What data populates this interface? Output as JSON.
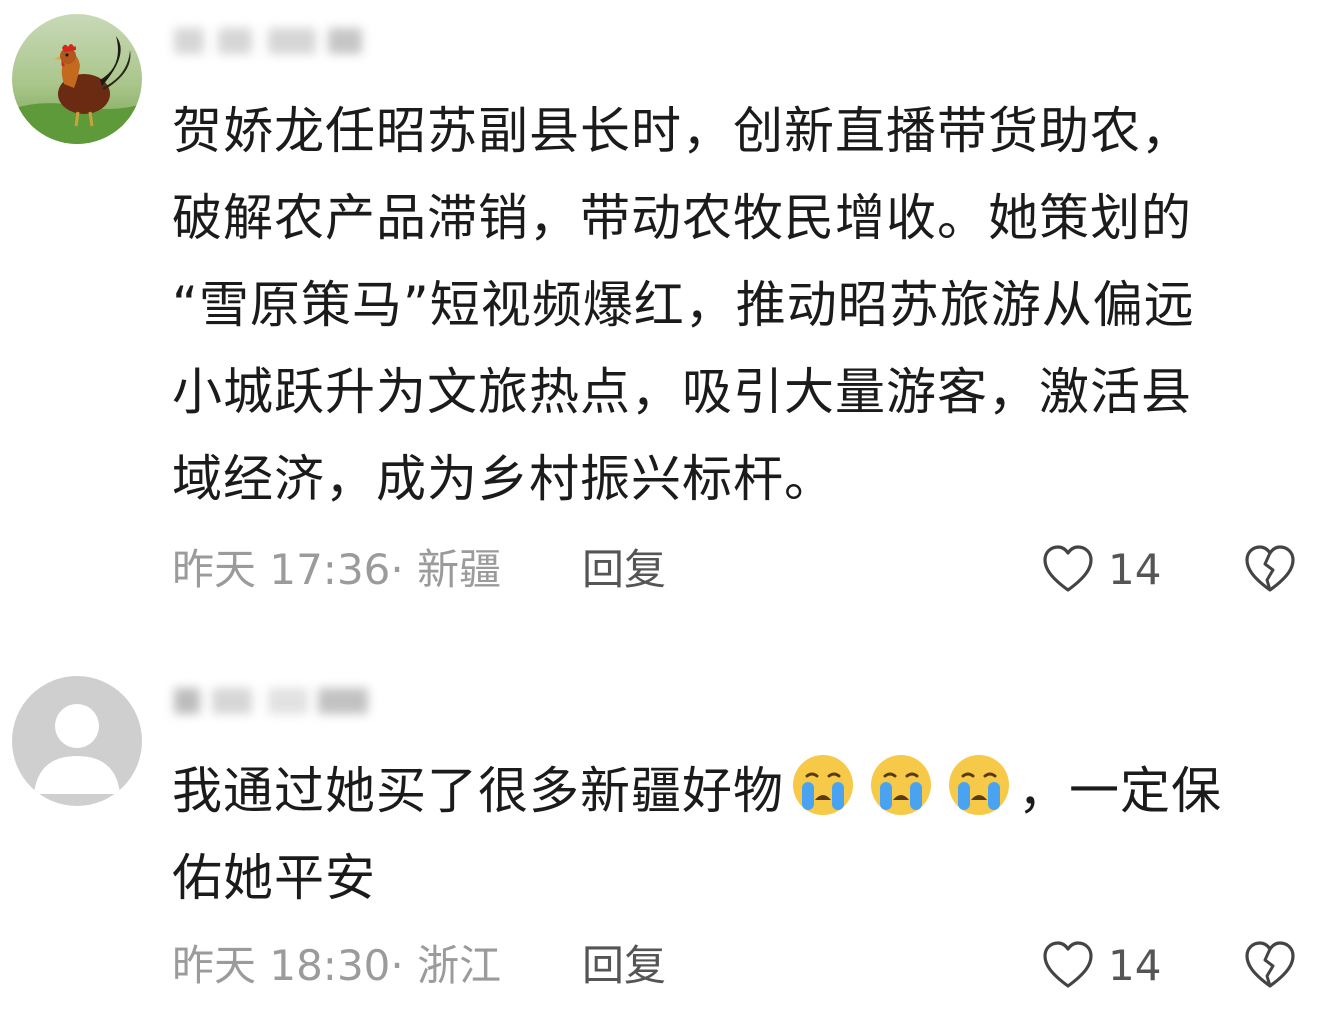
{
  "comments": [
    {
      "text_lines": [
        "贺娇龙任昭苏副县长时，创新直播带货助农，",
        "破解农产品滞销，带动农牧民增收。她策划的",
        "“雪原策马”短视频爆红，推动昭苏旅游从偏远",
        "小城跃升为文旅热点，吸引大量游客，激活县",
        "域经济，成为乡村振兴标杆。"
      ],
      "timestamp": "昨天 17:36",
      "location": "新疆",
      "time_location": "昨天 17:36· 新疆",
      "reply_label": "回复",
      "like_count": "14",
      "avatar": "rooster-avatar"
    },
    {
      "text_line1_a": "我通过她买了很多新疆好物",
      "text_line1_b": "，一定保",
      "text_line2": "佑她平安",
      "emojis": [
        "crying-emoji",
        "crying-emoji",
        "crying-emoji"
      ],
      "timestamp": "昨天 18:30",
      "location": "浙江",
      "time_location": "昨天 18:30· 浙江",
      "reply_label": "回复",
      "like_count": "14",
      "avatar": "default-person-avatar"
    }
  ],
  "colors": {
    "meta_gray": "#9b9b9b",
    "text": "#1b1b1b",
    "icon": "#444444",
    "emoji_face": "#f7c948",
    "emoji_tears": "#4aa3f0"
  }
}
